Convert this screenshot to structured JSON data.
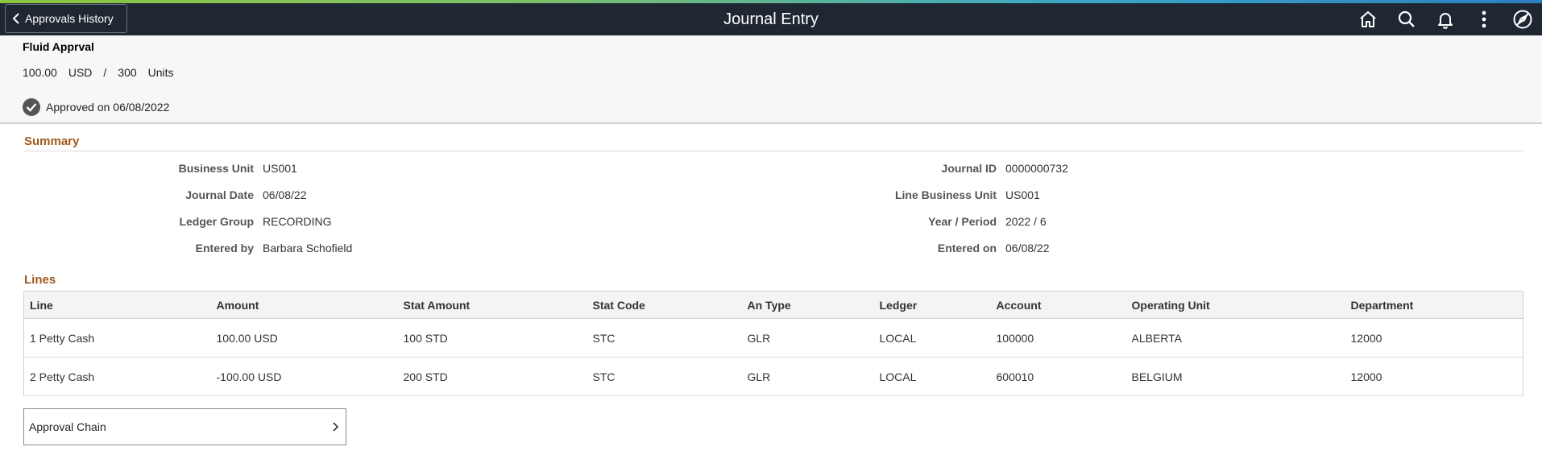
{
  "topbar": {
    "back_label": "Approvals History",
    "title": "Journal Entry",
    "icons": [
      "home-icon",
      "search-icon",
      "notification-bell-icon",
      "more-options-icon",
      "navbar-compass-icon"
    ]
  },
  "header": {
    "title": "Fluid Apprval",
    "amount": "100.00",
    "currency": "USD",
    "separator": "/",
    "quantity": "300",
    "unit": "Units",
    "status": "Approved on 06/08/2022"
  },
  "summary": {
    "title": "Summary",
    "left": [
      {
        "label": "Business Unit",
        "value": "US001"
      },
      {
        "label": "Journal Date",
        "value": "06/08/22"
      },
      {
        "label": "Ledger Group",
        "value": "RECORDING"
      },
      {
        "label": "Entered by",
        "value": "Barbara Schofield"
      }
    ],
    "right": [
      {
        "label": "Journal ID",
        "value": "0000000732"
      },
      {
        "label": "Line Business Unit",
        "value": "US001"
      },
      {
        "label": "Year / Period",
        "value": "2022 / 6"
      },
      {
        "label": "Entered on",
        "value": "06/08/22"
      }
    ]
  },
  "lines": {
    "title": "Lines",
    "columns": [
      "Line",
      "Amount",
      "Stat Amount",
      "Stat Code",
      "An Type",
      "Ledger",
      "Account",
      "Operating Unit",
      "Department"
    ],
    "rows": [
      [
        "1 Petty Cash",
        "100.00 USD",
        "100 STD",
        "STC",
        "GLR",
        "LOCAL",
        "100000",
        "ALBERTA",
        "12000"
      ],
      [
        "2 Petty Cash",
        "-100.00 USD",
        "200 STD",
        "STC",
        "GLR",
        "LOCAL",
        "600010",
        "BELGIUM",
        "12000"
      ]
    ]
  },
  "approval_chain": {
    "label": "Approval Chain"
  },
  "colors": {
    "topbar": "#1f2733",
    "section_title": "#a0581c",
    "header_bg": "#f7f7f7"
  }
}
